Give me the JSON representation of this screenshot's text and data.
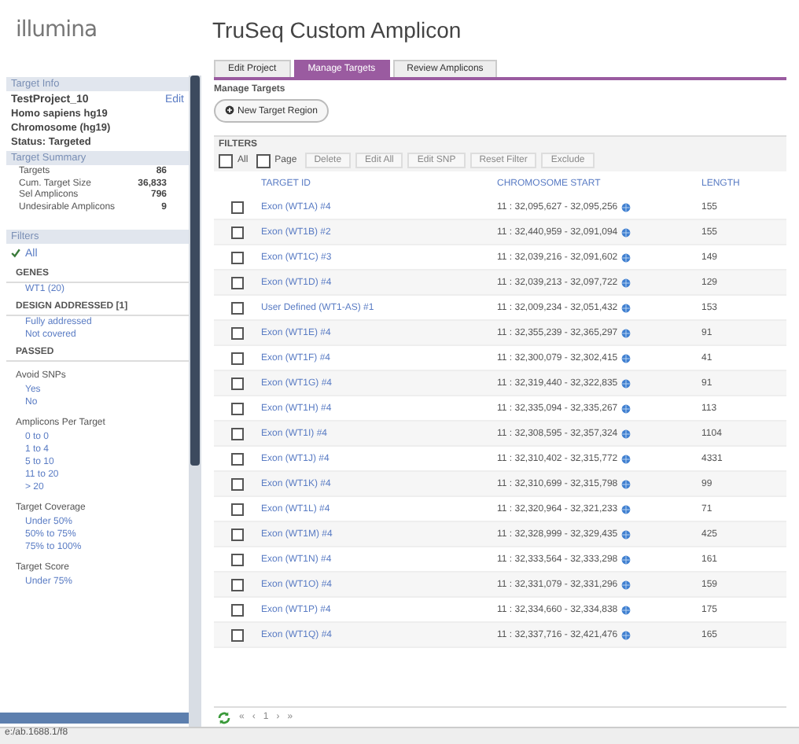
{
  "logo": "illumina",
  "app_title": "TruSeq Custom Amplicon",
  "sidebar": {
    "project_header": "Target Info",
    "project_name": "TestProject_10",
    "edit_link": "Edit",
    "project_lines": [
      "Homo sapiens hg19",
      "Chromosome (hg19)",
      "Status: Targeted"
    ],
    "summary_header": "Target Summary",
    "summary": [
      {
        "label": "Targets",
        "value": "86"
      },
      {
        "label": "Cum. Target Size",
        "value": "36,833"
      },
      {
        "label": "Sel Amplicons",
        "value": "796"
      },
      {
        "label": "Undesirable Amplicons",
        "value": "9"
      }
    ],
    "filters_header": "Filters",
    "filters": [
      {
        "kind": "check",
        "label": "All"
      },
      {
        "kind": "heading",
        "label": "GENES"
      },
      {
        "kind": "option",
        "label": "WT1 (20)"
      },
      {
        "kind": "heading",
        "label": "DESIGN ADDRESSED [1]"
      },
      {
        "kind": "option",
        "label": "Fully addressed"
      },
      {
        "kind": "option",
        "label": "Not covered"
      },
      {
        "kind": "heading",
        "label": "PASSED"
      },
      {
        "kind": "group",
        "label": "Avoid SNPs"
      },
      {
        "kind": "option",
        "label": "Yes"
      },
      {
        "kind": "option",
        "label": "No"
      },
      {
        "kind": "group",
        "label": "Amplicons Per Target"
      },
      {
        "kind": "option",
        "label": "0 to 0"
      },
      {
        "kind": "option",
        "label": "1 to 4"
      },
      {
        "kind": "option",
        "label": "5 to 10"
      },
      {
        "kind": "option",
        "label": "11 to 20"
      },
      {
        "kind": "option",
        "label": "> 20"
      },
      {
        "kind": "group",
        "label": "Target Coverage"
      },
      {
        "kind": "option",
        "label": "Under 50%"
      },
      {
        "kind": "option",
        "label": "50% to 75%"
      },
      {
        "kind": "option",
        "label": "75% to 100%"
      },
      {
        "kind": "group",
        "label": "Target Score"
      },
      {
        "kind": "option",
        "label": "Under 75%"
      }
    ]
  },
  "tabs": [
    {
      "label": "Edit Project",
      "selected": false
    },
    {
      "label": "Manage Targets",
      "selected": true
    },
    {
      "label": "Review Amplicons",
      "selected": false
    }
  ],
  "section_title": "Manage Targets",
  "new_button": "New Target Region",
  "filters_label": "FILTERS",
  "select_all": {
    "label": "All",
    "checked": false
  },
  "select_page": {
    "label": "Page",
    "checked": false
  },
  "toolbar": [
    "Delete",
    "Edit All",
    "Edit SNP",
    "Reset Filter",
    "Exclude"
  ],
  "columns": [
    "TARGET ID",
    "CHROMOSOME START",
    "LENGTH"
  ],
  "rows": [
    {
      "checked": false,
      "id": "Exon (WT1A) #4",
      "position": "11 : 32,095,627 - 32,095,256",
      "length": "155"
    },
    {
      "checked": false,
      "id": "Exon (WT1B) #2",
      "position": "11 : 32,440,959 - 32,091,094",
      "length": "155"
    },
    {
      "checked": false,
      "id": "Exon (WT1C) #3",
      "position": "11 : 32,039,216 - 32,091,602",
      "length": "149"
    },
    {
      "checked": false,
      "id": "Exon (WT1D) #4",
      "position": "11 : 32,039,213 - 32,097,722",
      "length": "129"
    },
    {
      "checked": false,
      "id": "User Defined (WT1-AS) #1",
      "position": "11 : 32,009,234 - 32,051,432",
      "length": "153"
    },
    {
      "checked": false,
      "id": "Exon (WT1E) #4",
      "position": "11 : 32,355,239 - 32,365,297",
      "length": "91"
    },
    {
      "checked": false,
      "id": "Exon (WT1F) #4",
      "position": "11 : 32,300,079 - 32,302,415",
      "length": "41"
    },
    {
      "checked": false,
      "id": "Exon (WT1G) #4",
      "position": "11 : 32,319,440 - 32,322,835",
      "length": "91"
    },
    {
      "checked": false,
      "id": "Exon (WT1H) #4",
      "position": "11 : 32,335,094 - 32,335,267",
      "length": "113"
    },
    {
      "checked": false,
      "id": "Exon (WT1I) #4",
      "position": "11 : 32,308,595 - 32,357,324",
      "length": "1104"
    },
    {
      "checked": false,
      "id": "Exon (WT1J) #4",
      "position": "11 : 32,310,402 - 32,315,772",
      "length": "4331"
    },
    {
      "checked": false,
      "id": "Exon (WT1K) #4",
      "position": "11 : 32,310,699 - 32,315,798",
      "length": "99"
    },
    {
      "checked": false,
      "id": "Exon (WT1L) #4",
      "position": "11 : 32,320,964 - 32,321,233",
      "length": "71"
    },
    {
      "checked": false,
      "id": "Exon (WT1M) #4",
      "position": "11 : 32,328,999 - 32,329,435",
      "length": "425"
    },
    {
      "checked": false,
      "id": "Exon (WT1N) #4",
      "position": "11 : 32,333,564 - 32,333,298",
      "length": "161"
    },
    {
      "checked": false,
      "id": "Exon (WT1O) #4",
      "position": "11 : 32,331,079 - 32,331,296",
      "length": "159"
    },
    {
      "checked": false,
      "id": "Exon (WT1P) #4",
      "position": "11 : 32,334,660 - 32,334,838",
      "length": "175"
    },
    {
      "checked": false,
      "id": "Exon (WT1Q) #4",
      "position": "11 : 32,337,716 - 32,421,476",
      "length": "165"
    }
  ],
  "pager": [
    "«",
    "‹",
    "1",
    "›",
    "»"
  ],
  "status_bar": "e:/ab.1688.1/f8"
}
